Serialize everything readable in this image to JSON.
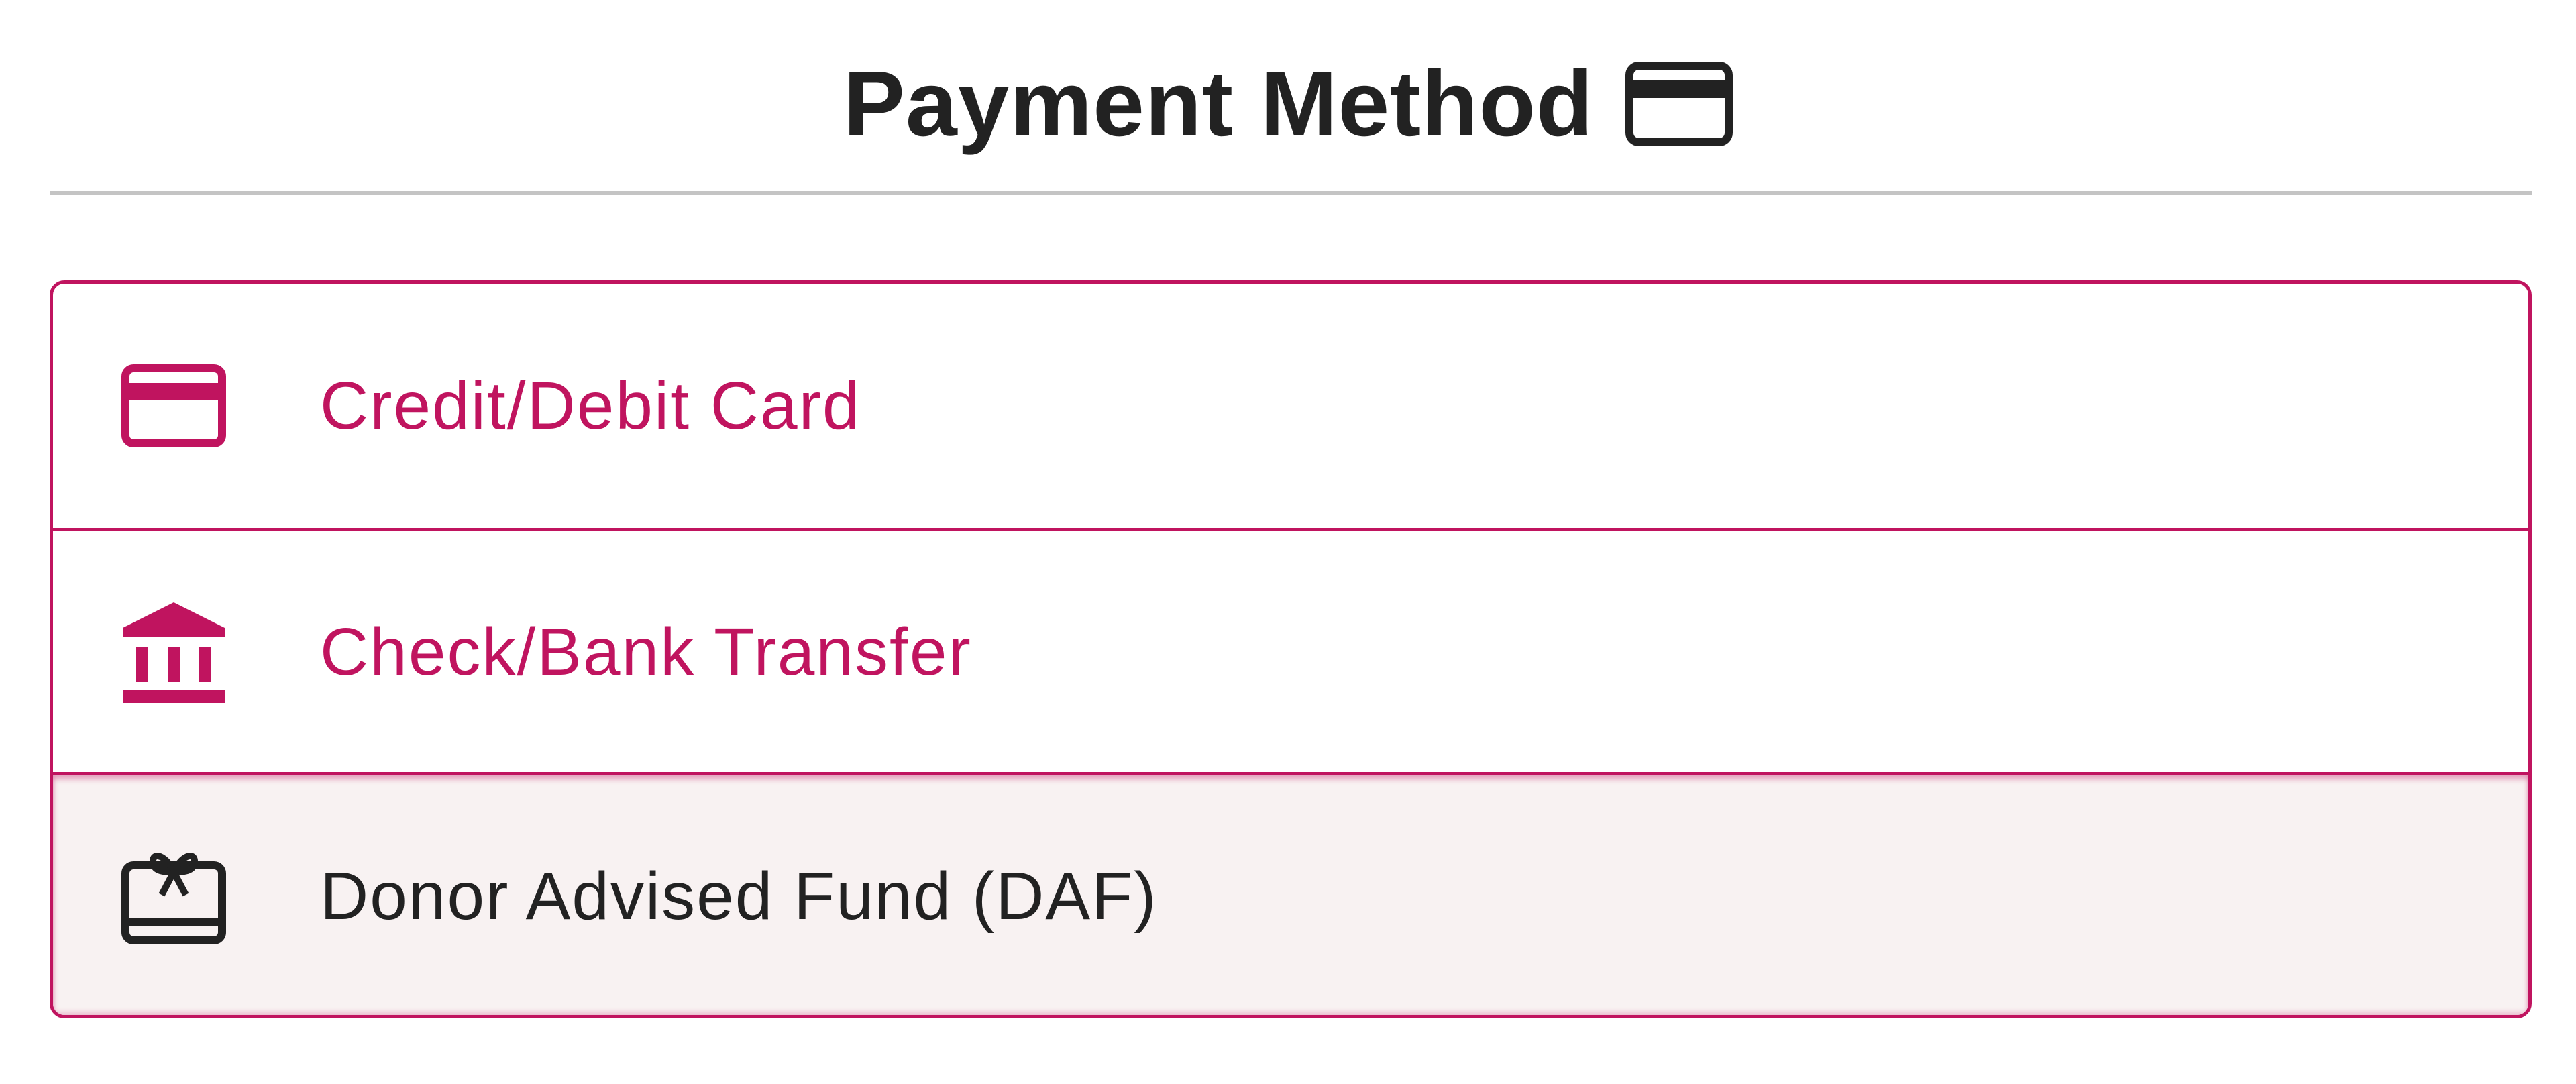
{
  "header": {
    "title": "Payment Method",
    "icon": "credit-card-icon"
  },
  "options": [
    {
      "label": "Credit/Debit Card",
      "icon": "credit-card-icon",
      "selected": false
    },
    {
      "label": "Check/Bank Transfer",
      "icon": "bank-icon",
      "selected": false
    },
    {
      "label": "Donor Advised Fund (DAF)",
      "icon": "gift-card-icon",
      "selected": true
    }
  ],
  "colors": {
    "accent": "#c0145f",
    "text": "#222222",
    "selected_bg": "#f8f2f2",
    "divider": "#c4c4c4"
  }
}
